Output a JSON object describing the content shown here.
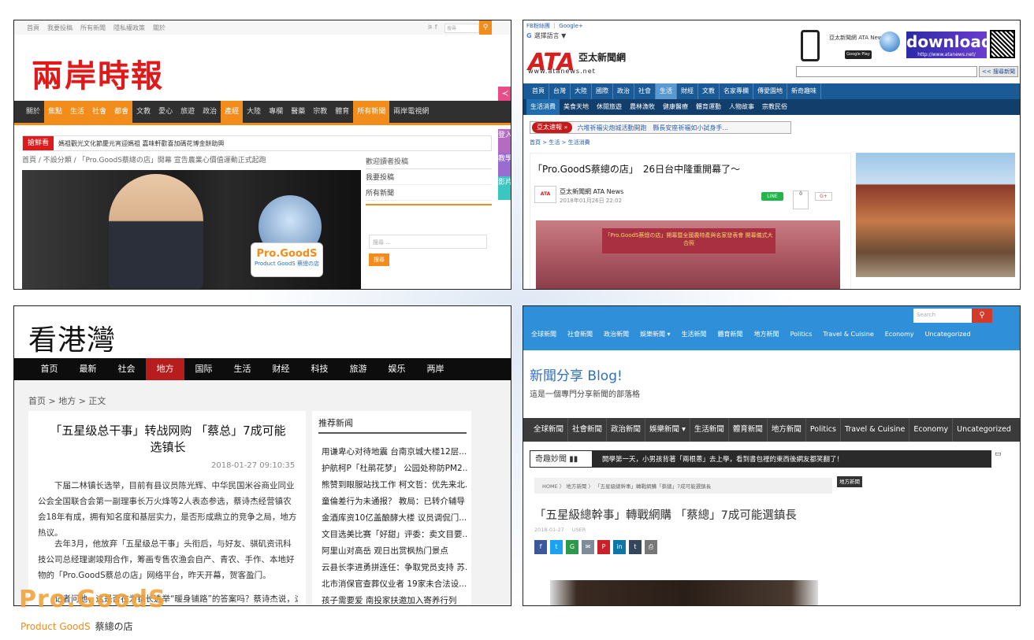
{
  "panel1": {
    "topbar_links": [
      "首頁",
      "我要投稿",
      "所有新聞",
      "隱私權政策",
      "關於"
    ],
    "search_placeholder": "搜尋",
    "logo": "兩岸時報",
    "nav": [
      "關於",
      "焦點",
      "生活",
      "社會",
      "都會",
      "文教",
      "愛心",
      "旅遊",
      "政治",
      "產經",
      "大陸",
      "專欄",
      "醫藥",
      "宗教",
      "體育",
      "所有新聞",
      "兩岸電視網"
    ],
    "nav_highlighted": [
      "焦點",
      "生活",
      "社會",
      "都會",
      "產經",
      "所有新聞"
    ],
    "ticker_label": "搶鮮看",
    "ticker_text": "媽祖觀光文化節慶元宵迎媽祖 嘉味軒歡喜加碼花博金餅助興",
    "breadcrumb": "首頁 / 不設分類 / 「Pro.GoodS蔡總の店」開幕 宣告農業心價值運動正式起跑",
    "sidebar_title": "歡迎讀者投稿",
    "sidebar_links": [
      "我要投稿",
      "所有新聞"
    ],
    "sidebar_search_placeholder": "搜尋 ...",
    "sidebar_search_button": "搜尋",
    "side_tabs": [
      "登入",
      "教學",
      "影片"
    ],
    "sign_card_title": "Pro.GoodS",
    "sign_card_sub": "Product GoodS 蔡總の店"
  },
  "panel2": {
    "top_links": "FB粉絲團 ｜ Google+",
    "google_translate": "選擇語言 ▼",
    "logo": "ATA",
    "logo_sub": "亞太新聞網",
    "url": "www.atanews.net",
    "brand_text": "亞太新聞網 ATA News",
    "google_play": "Google Play",
    "download_label": "download",
    "download_url": "http://www.atanews.net/",
    "search_button": "<< 搜尋新聞",
    "nav": [
      "首頁",
      "台灣",
      "大陸",
      "國際",
      "政治",
      "社會",
      "生活",
      "財經",
      "文教",
      "名家專欄",
      "傳愛園地",
      "新奇趣味"
    ],
    "nav_active": "生活",
    "subnav": [
      "生活消費",
      "美食天地",
      "休閒旅遊",
      "農林漁牧",
      "健康醫療",
      "體育運動",
      "人物故事",
      "宗教民俗"
    ],
    "subnav_active": "生活消費",
    "breaking_label": "亞太速報 »",
    "breaking_text": "六堆祈福尖炮城活動開跑　縣長安座祈福如小試身手...",
    "breadcrumb": "首頁 > 生活 > 生活消費",
    "article_title": "「Pro.GoodS蔡總の店」　26日台中隆重開幕了～",
    "author": "亞太新聞網 ATA News",
    "date": "2018年01月26日 22:02",
    "line_button": "LINE",
    "fb_count": "0",
    "gplus": "G+",
    "banner_text": "「Pro.GoodS蔡總の店」開幕暨全國農特產與名家發表會 開幕儀式大合照"
  },
  "panel3": {
    "logo": "看港灣",
    "nav": [
      "首页",
      "最新",
      "社会",
      "地方",
      "国际",
      "生活",
      "财经",
      "科技",
      "旅游",
      "娱乐",
      "两岸"
    ],
    "nav_active": "地方",
    "breadcrumb": "首页 > 地方 > 正文",
    "title": "「五星级总干事」转战网购 「蔡总」7成可能选镇长",
    "date": "2018-01-27 09:10:35",
    "paragraphs": [
      "下届二林镇长选举，目前有县议员陈光辉、中华民国米谷商业同业公会全国联合会第一副理事长万火烽等2人表态参选，蔡诗杰经营镇农会18年有成，拥有知名度和基层实力，是否形成鼎立的竞争之局，地方热议。",
      "去年3月，他放弃「五星级总干事」头衔后，与好友、骐矶资讯科技公司总经理谢竣翔合作，筹画专售农渔会自产、青农、手作、本地好物的「Pro.GoodS蔡总の店」网络平台，昨天开幕，贺客盈门。",
      "记者问他，这是否在为镇长选举“暖身铺路”的答案吗？蔡诗杰说，这是他"
    ],
    "sidebar_title": "推荐新闻",
    "sidebar_items": [
      "用谦卑心对待地震 台南京城大楼12层...",
      "护航柯P「杜鹃花梦」 公园处称防PM2...",
      "熊赞到眼服站找工作 柯文哲：优先来北...",
      "童倫差行为未通报？ 教局：已转介辅导",
      "金酒库资10亿盖酿酵大楼 议员调侃门...",
      "文目选美比赛「好甜」评委：卖文目要...",
      "阿里山对高岳 观日出赏枫热门景点",
      "云县长李进勇拼连任：争取党员支持 苏...",
      "北市消保官查葬仪业者 19家未合法设...",
      "孩子需要爱 南投家扶邀加入寄养行列"
    ]
  },
  "panel4": {
    "search_placeholder": "Search",
    "top_nav": [
      "全球新聞",
      "社會新聞",
      "政治新聞",
      "娛樂新聞 ▾",
      "生活新聞",
      "體育新聞",
      "地方新聞",
      "Politics",
      "Travel & Cuisine",
      "Economy",
      "Uncategorized"
    ],
    "blog_title": "新聞分享 Blog!",
    "blog_subtitle": "這是一個專門分享新聞的部落格",
    "nav": [
      "全球新聞",
      "社會新聞",
      "政治新聞",
      "娛樂新聞 ▾",
      "生活新聞",
      "體育新聞",
      "地方新聞",
      "Politics",
      "Travel & Cuisine",
      "Economy",
      "Uncategorized"
    ],
    "ticker_label": "奇趣妙聞",
    "ticker_text": "開學第一天，小男孩背著「兩根蔥」去上學，看到書包裡的東西後網友都笑翻了！",
    "breadcrumb": "HOME  〉 地方新聞  〉 「五星級總幹事」轉戰網購「蔡總」7成可能選鎮長",
    "tag": "地方新聞",
    "article_title": "「五星級總幹事」轉戰網購 「蔡總」7成可能選鎮長",
    "meta_date": "2018-01-27",
    "meta_author": "USER",
    "share_icons": [
      "f",
      "t",
      "G",
      "✉",
      "P",
      "in",
      "t",
      "⎙"
    ],
    "share_colors": [
      "#3b5998",
      "#1da1f2",
      "#2c9a4a",
      "#7d8c96",
      "#cb2027",
      "#0e76a8",
      "#35465c",
      "#777777"
    ]
  },
  "footer_logo": {
    "main": "Pro.GoodS",
    "sub": "Product GoodS",
    "sub_cn": "蔡總の店"
  }
}
